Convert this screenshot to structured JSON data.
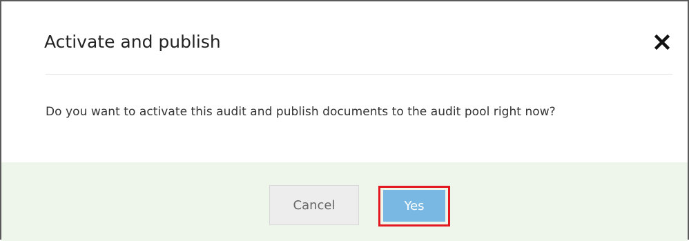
{
  "dialog": {
    "title": "Activate and publish",
    "message": "Do you want to activate this audit and publish documents to the audit pool right now?",
    "close_icon": "close-icon",
    "buttons": {
      "cancel_label": "Cancel",
      "yes_label": "Yes"
    },
    "colors": {
      "footer_background": "#eef6ec",
      "yes_button": "#79b8e2",
      "cancel_button": "#ededed",
      "highlight_border": "#e3171f"
    }
  }
}
